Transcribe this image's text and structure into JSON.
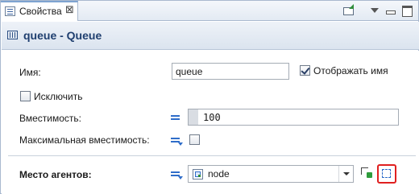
{
  "tab": {
    "label": "Свойства"
  },
  "title": "queue - Queue",
  "fields": {
    "name_label": "Имя:",
    "name_value": "queue",
    "show_name_label": "Отображать имя",
    "exclude_label": "Исключить",
    "capacity_label": "Вместимость:",
    "capacity_value": "100",
    "max_capacity_label": "Максимальная вместимость:",
    "agent_place_label": "Место агентов:",
    "agent_place_value": "node"
  },
  "state": {
    "show_name_checked": true,
    "exclude_checked": false,
    "max_capacity_checked": false
  },
  "colors": {
    "accent": "#2f6dc9",
    "title_text": "#1f3f6f",
    "highlight_border": "#e02020"
  },
  "icons": {
    "tab": "properties-icon",
    "title": "queue-icon",
    "pin": "pin-icon",
    "menu": "view-menu-icon",
    "minimize": "minimize-icon",
    "maximize": "maximize-icon",
    "equals": "static-value-icon",
    "equals_dynamic": "dynamic-value-icon",
    "node": "node-icon",
    "pick": "pick-from-graph-icon",
    "select_area": "select-area-icon"
  }
}
